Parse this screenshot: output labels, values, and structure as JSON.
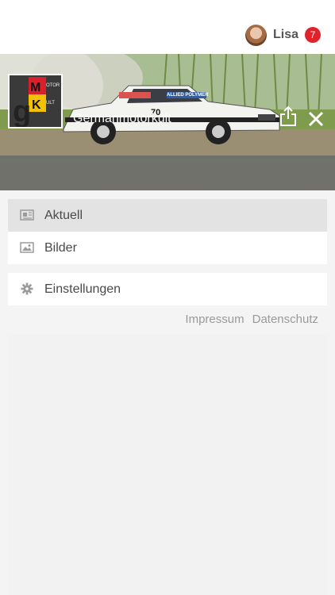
{
  "user": {
    "name": "Lisa",
    "notification_count": "7"
  },
  "header": {
    "title": "Germanmotorkult"
  },
  "menu": {
    "items": [
      {
        "label": "Aktuell",
        "icon": "newspaper-icon",
        "active": true
      },
      {
        "label": "Bilder",
        "icon": "image-icon",
        "active": false
      }
    ],
    "settings": {
      "label": "Einstellungen",
      "icon": "gear-icon"
    }
  },
  "footer_links": {
    "impressum": "Impressum",
    "datenschutz": "Datenschutz"
  },
  "hero": {
    "car_number": "70",
    "sponsor": "ALLIED POLYMER",
    "logo_text": "gMOTORKULT"
  },
  "colors": {
    "badge": "#e0232b",
    "hero_bar": "#6e6e6e",
    "logo_red": "#d81f2a",
    "logo_yellow": "#f2c200"
  }
}
